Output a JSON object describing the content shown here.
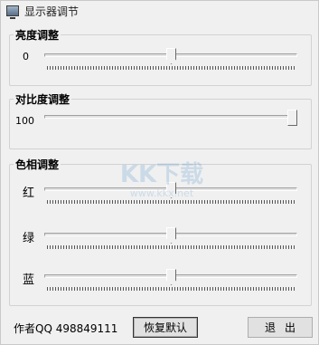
{
  "window": {
    "title": "显示器调节"
  },
  "brightness": {
    "legend": "亮度调整",
    "value_text": "0",
    "level": 0.5
  },
  "contrast": {
    "legend": "对比度调整",
    "value_text": "100",
    "level": 1.0
  },
  "hue": {
    "legend": "色相调整",
    "channels": [
      {
        "label": "红",
        "level": 0.5
      },
      {
        "label": "绿",
        "level": 0.5
      },
      {
        "label": "蓝",
        "level": 0.5
      }
    ]
  },
  "footer": {
    "author": "作者QQ 498849111",
    "restore_label": "恢复默认",
    "exit_label": "退出"
  },
  "watermark": {
    "text": "KK下载",
    "url": "www.kkx.net"
  }
}
